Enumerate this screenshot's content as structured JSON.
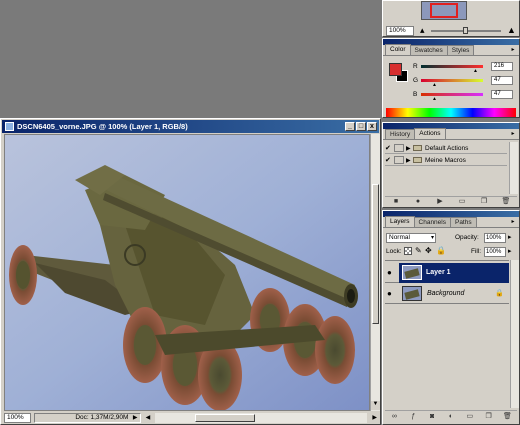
{
  "navigator": {
    "zoom_value": "100%"
  },
  "color_panel": {
    "tabs": [
      "Color",
      "Swatches",
      "Styles"
    ],
    "channels": [
      {
        "label": "R",
        "value": "216",
        "fraction": 0.85
      },
      {
        "label": "G",
        "value": "47",
        "fraction": 0.18
      },
      {
        "label": "B",
        "value": "47",
        "fraction": 0.18
      }
    ],
    "foreground_color": "#d82f2f",
    "background_color": "#000000"
  },
  "document": {
    "title": "DSCN6405_vorne.JPG @ 100% (Layer 1, RGB/8)",
    "minimize": "_",
    "restore": "□",
    "close": "x",
    "zoom_value": "100%",
    "doc_info": "Doc: 1,37M/2,90M"
  },
  "history_panel": {
    "tabs": [
      "History",
      "Actions"
    ],
    "items": [
      {
        "label": "Default Actions"
      },
      {
        "label": "Meine Macros"
      }
    ]
  },
  "layers_panel": {
    "tabs": [
      "Layers",
      "Channels",
      "Paths"
    ],
    "blend_mode": "Normal",
    "opacity_label": "Opacity:",
    "opacity_value": "100%",
    "lock_label": "Lock:",
    "fill_label": "Fill:",
    "fill_value": "100%",
    "layers": [
      {
        "name": "Layer 1",
        "selected": true
      },
      {
        "name": "Background",
        "selected": false
      }
    ]
  },
  "colors": {
    "accent": "#0a246a",
    "panel_bg": "#d4d0c8",
    "workspace": "#7a7a7a"
  }
}
